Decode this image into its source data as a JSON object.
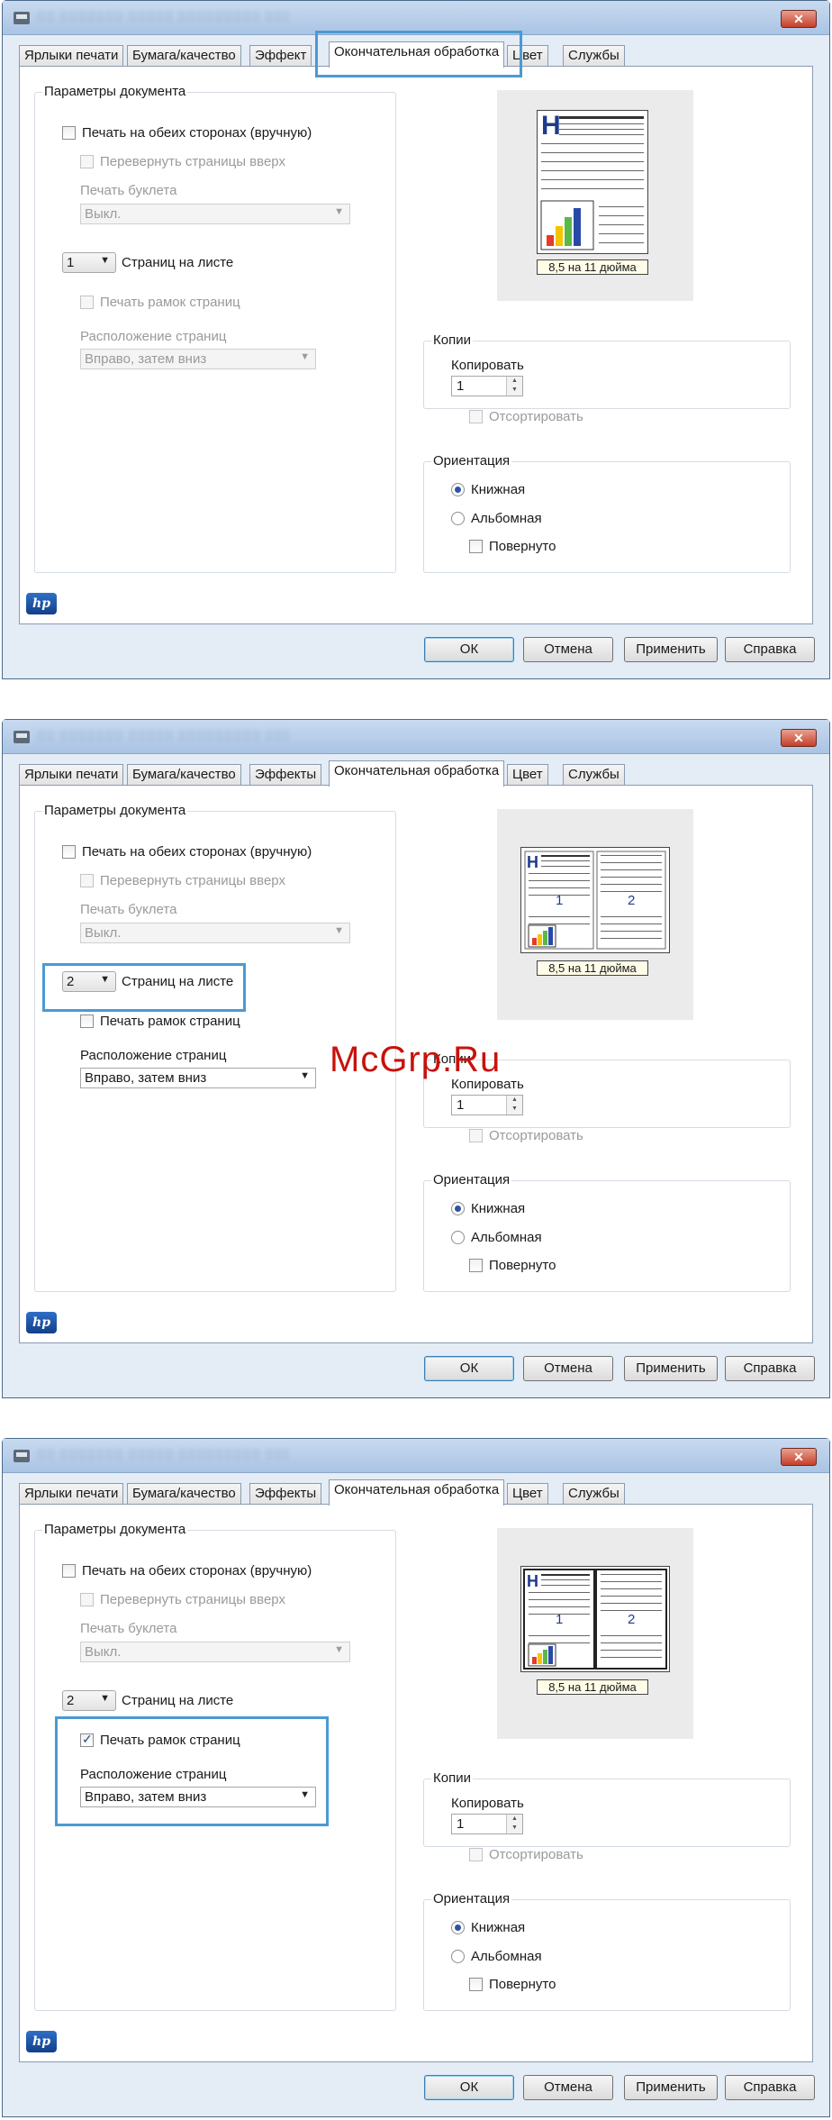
{
  "tabs": [
    "Ярлыки печати",
    "Бумага/качество",
    "Эффекты",
    "Окончательная обработка",
    "Цвет",
    "Службы"
  ],
  "tabs_first_panel": [
    "Ярлыки печати",
    "Бумага/качество",
    "Эффект",
    "Окончательная обработка",
    "Цвет",
    "Службы"
  ],
  "doc_options": {
    "group_label": "Параметры документа",
    "duplex_label": "Печать на обеих сторонах (вручную)",
    "flip_label": "Перевернуть страницы вверх",
    "booklet_label": "Печать буклета",
    "booklet_value": "Выкл.",
    "pages_per_sheet_label": "Страниц на листе",
    "borders_label": "Печать рамок страниц",
    "order_label": "Расположение страниц",
    "order_value": "Вправо, затем вниз"
  },
  "preview": {
    "size_label": "8,5 на 11 дюйма",
    "page_one": "1",
    "page_two": "2",
    "heading_glyph": "H"
  },
  "copies": {
    "group_label": "Копии",
    "copies_label": "Копировать",
    "copies_value": "1",
    "collate_label": "Отсортировать"
  },
  "orientation": {
    "group_label": "Ориентация",
    "portrait_label": "Книжная",
    "landscape_label": "Альбомная",
    "rotate_label": "Повернуто"
  },
  "buttons": {
    "ok": "ОК",
    "cancel": "Отмена",
    "apply": "Применить",
    "help": "Справка"
  },
  "window": {
    "close_glyph": "✕"
  },
  "logo_text": "hp",
  "watermark": "McGrp.Ru",
  "states": [
    {
      "pages_per_sheet": "1",
      "borders_checked": false,
      "borders_enabled": false,
      "order_enabled": false
    },
    {
      "pages_per_sheet": "2",
      "borders_checked": false,
      "borders_enabled": true,
      "order_enabled": true
    },
    {
      "pages_per_sheet": "2",
      "borders_checked": true,
      "borders_enabled": true,
      "order_enabled": true
    }
  ],
  "colors": {
    "highlight": "#4a9ad4",
    "watermark": "#c8120c"
  }
}
